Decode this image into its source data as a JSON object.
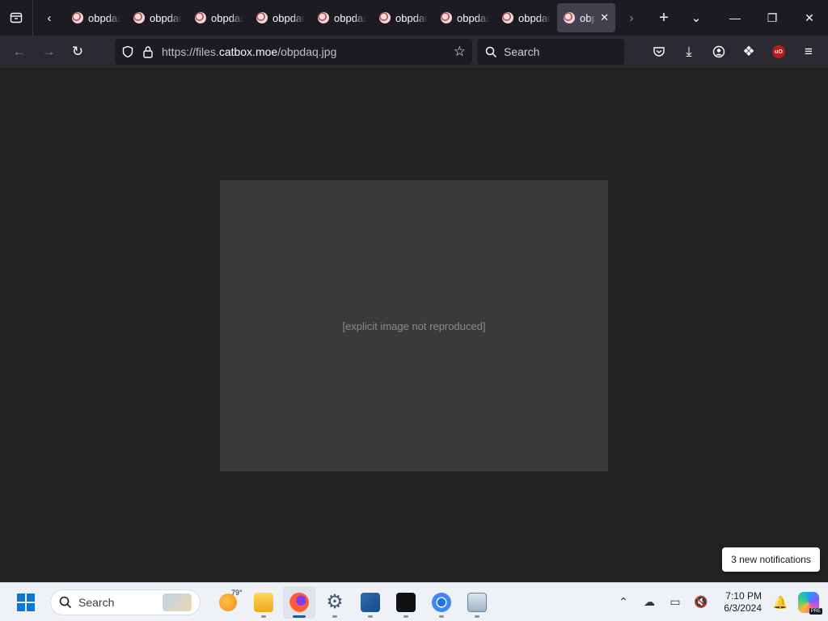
{
  "browser": {
    "tabs": [
      {
        "title": "obpdaq.jpg",
        "active": false
      },
      {
        "title": "obpdaq.jpg",
        "active": false
      },
      {
        "title": "obpdaq.jpg",
        "active": false
      },
      {
        "title": "obpdaq.jpg",
        "active": false
      },
      {
        "title": "obpdaq.jpg",
        "active": false
      },
      {
        "title": "obpdaq.jpg",
        "active": false
      },
      {
        "title": "obpdaq.jpg",
        "active": false
      },
      {
        "title": "obpdaq.jpg",
        "active": false
      },
      {
        "title": "obpdaq.jpg",
        "active": true
      }
    ],
    "url_prefix": "https://files.",
    "url_host": "catbox.moe",
    "url_path": "/obpdaq.jpg",
    "search_placeholder": "Search",
    "content_placeholder": "[explicit image not reproduced]"
  },
  "notification_toast": "3 new notifications",
  "taskbar": {
    "search_placeholder": "Search",
    "weather_temp": "79°",
    "time": "7:10 PM",
    "date": "6/3/2024",
    "copilot_badge": "PRE"
  },
  "colors": {
    "tab_strip_bg": "#1c1b22",
    "toolbar_bg": "#2b2a33",
    "active_tab_bg": "#42414d",
    "content_bg": "#232323",
    "taskbar_bg": "#eef1f6",
    "accent": "#0067c0"
  }
}
